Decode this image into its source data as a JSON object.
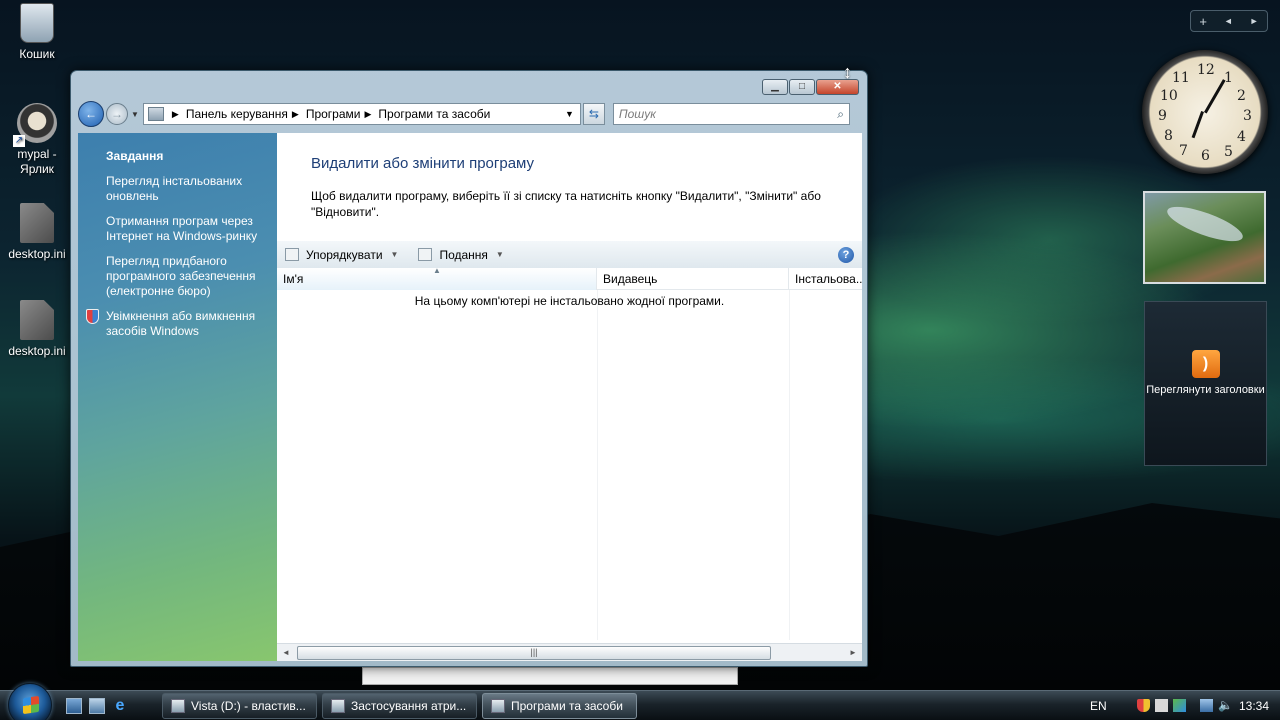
{
  "desktop": {
    "icons": [
      {
        "label": "Кошик"
      },
      {
        "label": "mypal - Ярлик"
      },
      {
        "label": "desktop.ini"
      },
      {
        "label": "desktop.ini"
      }
    ]
  },
  "gadgets": {
    "bar": {
      "add": "+",
      "prev": "◄",
      "next": "►"
    },
    "clock_numbers": [
      "12",
      "1",
      "2",
      "3",
      "4",
      "5",
      "6",
      "7",
      "8",
      "9",
      "10",
      "11"
    ],
    "rss_label": "Переглянути заголовки"
  },
  "window": {
    "caption": {
      "min": "▁",
      "max": "□",
      "close": "✕"
    },
    "breadcrumb": [
      "Панель керування",
      "Програми",
      "Програми та засоби"
    ],
    "search_placeholder": "Пошук",
    "tasks": {
      "title": "Завдання",
      "links": [
        "Перегляд інстальованих оновлень",
        "Отримання програм через Інтернет на Windows-ринку",
        "Перегляд придбаного програмного забезпечення (електронне бюро)",
        "Увімкнення або вимкнення засобів Windows"
      ]
    },
    "content": {
      "heading": "Видалити або змінити програму",
      "description": "Щоб видалити програму, виберіть її зі списку та натисніть кнопку \"Видалити\", \"Змінити\" або \"Відновити\".",
      "toolbar": {
        "organize": "Упорядкувати",
        "views": "Подання",
        "help": "?"
      },
      "columns": [
        "Ім'я",
        "Видавець",
        "Інстальова..."
      ],
      "empty_message": "На цьому комп'ютері не інстальовано жодної програми."
    }
  },
  "taskbar": {
    "buttons": [
      {
        "label": "Vista (D:) - властив...",
        "active": false
      },
      {
        "label": "Застосування атри...",
        "active": false
      },
      {
        "label": "Програми та засоби",
        "active": true
      }
    ],
    "language": "EN",
    "time": "13:34"
  }
}
